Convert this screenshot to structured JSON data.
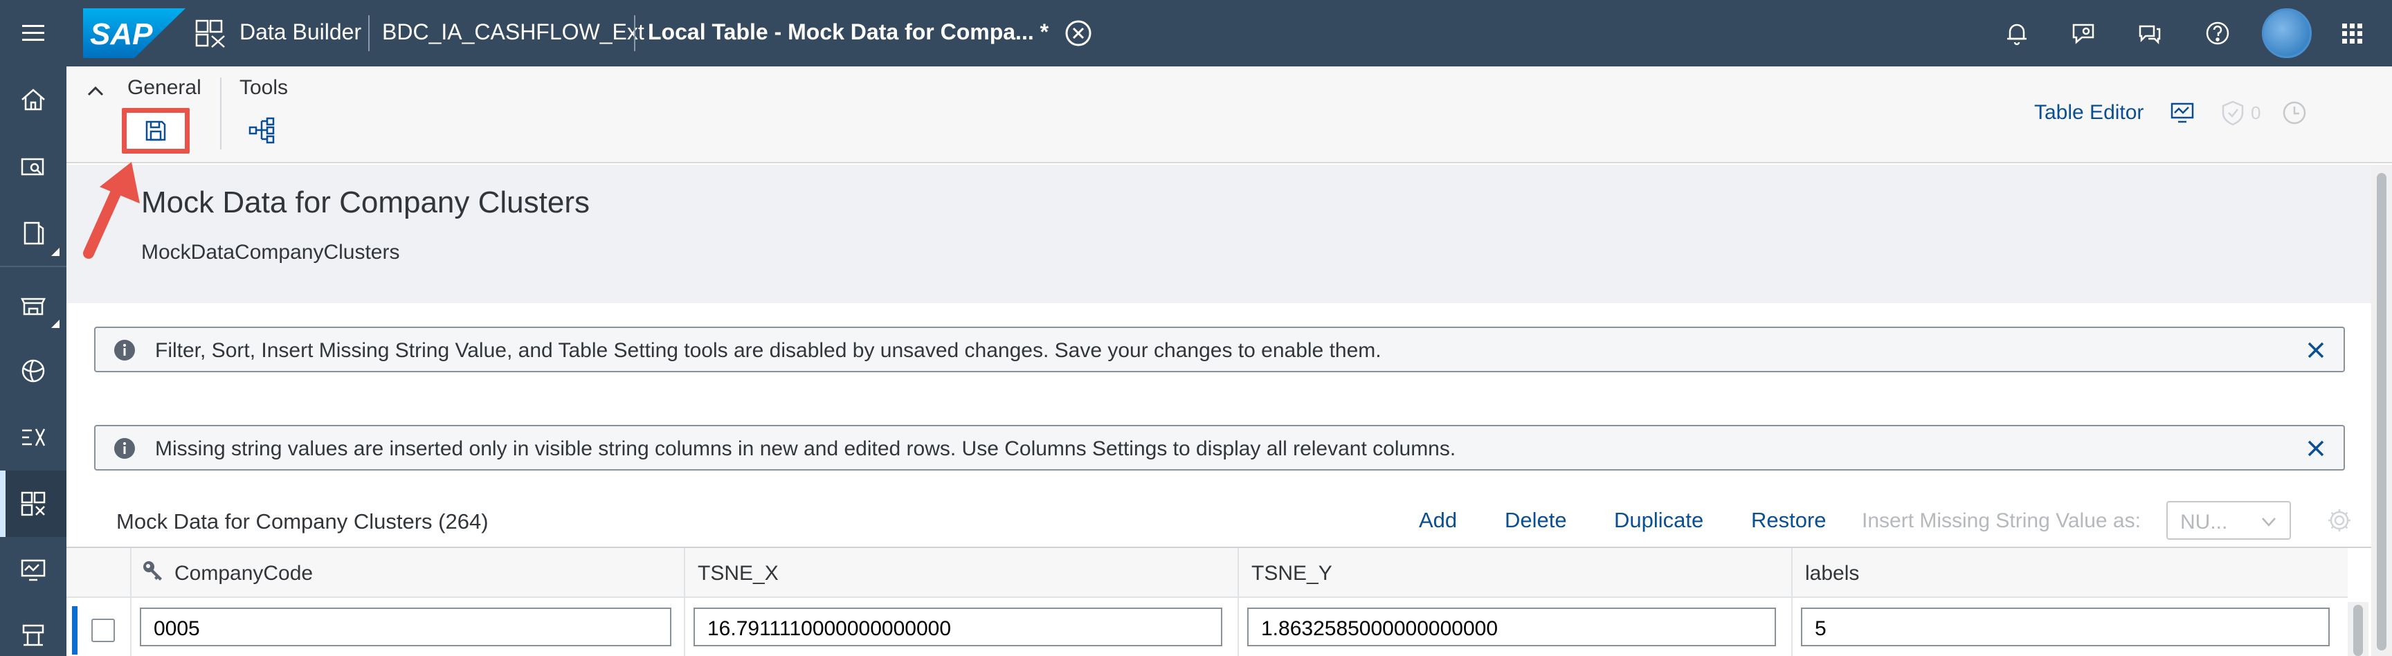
{
  "shell": {
    "logo_text": "SAP",
    "app_name": "Data Builder",
    "space_name": "BDC_IA_CASHFLOW_Ext",
    "document_tab": "Local Table - Mock Data for Compa... *",
    "icons": [
      "notification-icon",
      "feedback-icon",
      "help-chat-icon",
      "help-icon",
      "avatar",
      "product-switch-icon"
    ]
  },
  "leftnav": {
    "items": [
      "home-icon",
      "repository-explorer-icon",
      "catalog-icon",
      "marketplace-icon",
      "data-access-icon",
      "data-integration-icon",
      "data-builder-icon",
      "data-integration-monitor-icon",
      "space-management-icon"
    ]
  },
  "toolbar": {
    "tab_general": "General",
    "tab_tools": "Tools",
    "table_editor": "Table Editor",
    "badge_count": "0"
  },
  "header": {
    "title": "Mock Data for Company Clusters",
    "subtitle": "MockDataCompanyClusters"
  },
  "strips": [
    {
      "message": "Filter, Sort, Insert Missing String Value, and Table Setting tools are disabled by unsaved changes. Save your changes to enable them."
    },
    {
      "message": "Missing string values are inserted only in visible string columns in new and edited rows. Use Columns Settings to display all relevant columns."
    }
  ],
  "table": {
    "title": "Mock Data for Company Clusters (264)",
    "actions": {
      "add": "Add",
      "delete": "Delete",
      "duplicate": "Duplicate",
      "restore": "Restore"
    },
    "insert_label": "Insert Missing String Value as:",
    "insert_value": "NU...",
    "columns": [
      "CompanyCode",
      "TSNE_X",
      "TSNE_Y",
      "labels"
    ],
    "rows": [
      [
        "0005",
        "16.7911110000000000000",
        "1.8632585000000000000",
        "5"
      ]
    ]
  },
  "colors": {
    "shell": "#354a5f",
    "link": "#0a4f91",
    "highlight": "#e8534a"
  }
}
